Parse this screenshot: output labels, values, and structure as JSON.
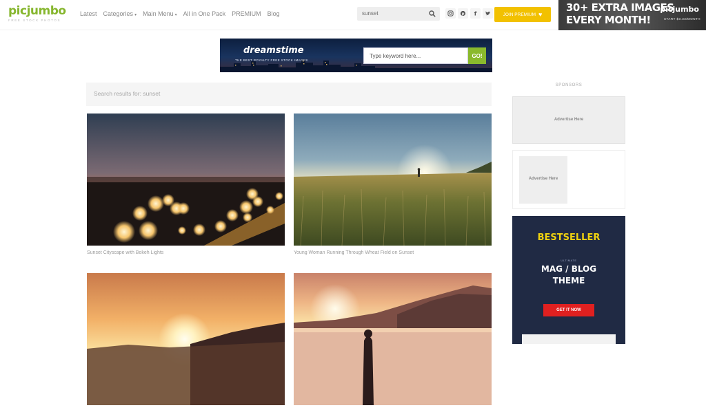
{
  "header": {
    "logo_name": "picjumbo",
    "logo_tagline": "FREE STOCK PHOTOS",
    "nav": [
      {
        "label": "Latest",
        "dropdown": false
      },
      {
        "label": "Categories",
        "dropdown": true
      },
      {
        "label": "Main Menu",
        "dropdown": true
      },
      {
        "label": "All in One Pack",
        "dropdown": false
      },
      {
        "label": "PREMIUM",
        "dropdown": false
      },
      {
        "label": "Blog",
        "dropdown": false
      }
    ],
    "search_value": "sunset",
    "socials": [
      "instagram-icon",
      "pinterest-icon",
      "facebook-icon",
      "twitter-icon"
    ],
    "join_label": "JOIN PREMIUM",
    "promo": {
      "line1": "30+ EXTRA IMAGES",
      "line2": "EVERY MONTH!",
      "brand": "picjumbo",
      "sub": "START $3.33/MONTH"
    }
  },
  "banner": {
    "brand": "dreamstime",
    "sub": "THE BEST ROYALTY FREE STOCK IMAGES",
    "search_placeholder": "Type keyword here...",
    "go_label": "GO!"
  },
  "results": {
    "text": "Search results for: sunset"
  },
  "photos": [
    {
      "caption": "Sunset Cityscape with Bokeh Lights",
      "scene": "city-bokeh"
    },
    {
      "caption": "Young Woman Running Through Wheat Field on Sunset",
      "scene": "wheat-field"
    },
    {
      "caption": "",
      "scene": "sun-hills"
    },
    {
      "caption": "",
      "scene": "lake-mountains"
    }
  ],
  "sidebar": {
    "sponsors_label": "SPONSORS",
    "ad1_label": "Advertise Here",
    "ad2_label": "Advertise Here",
    "ad3": {
      "bestseller": "BESTSELLER",
      "small": "ULTIMATE",
      "title1": "MAG / BLOG",
      "title2": "THEME",
      "button": "GET IT NOW"
    }
  },
  "colors": {
    "brand_green": "#86b62e",
    "join_yellow": "#f2c100",
    "ad_navy": "#202a44",
    "ad_yellow": "#f0d20f",
    "ad_red": "#e02020"
  }
}
